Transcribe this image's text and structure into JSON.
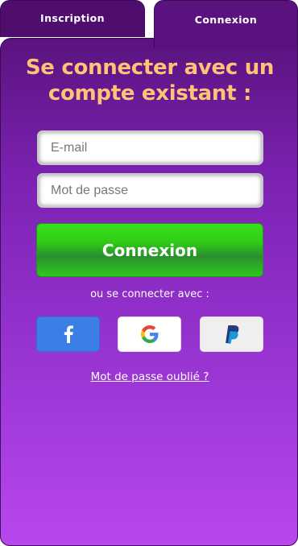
{
  "tabs": [
    {
      "label": "Inscription",
      "active": false
    },
    {
      "label": "Connexion",
      "active": true
    }
  ],
  "login": {
    "title": "Se connecter avec un compte existant :",
    "email_placeholder": "E-mail",
    "password_placeholder": "Mot de passe",
    "submit_label": "Connexion",
    "alt_text": "ou se connecter avec :",
    "forgot_label": "Mot de passe oublié ?"
  },
  "social": [
    {
      "icon": "facebook-icon",
      "color": "#3b7ee6"
    },
    {
      "icon": "google-icon",
      "color": "#ffffff"
    },
    {
      "icon": "paypal-icon",
      "color": "#efefef"
    }
  ],
  "colors": {
    "title": "#ffc277",
    "panel_top": "#5a137e",
    "panel_bottom": "#b847ee",
    "button_green": "#2fcc17"
  }
}
